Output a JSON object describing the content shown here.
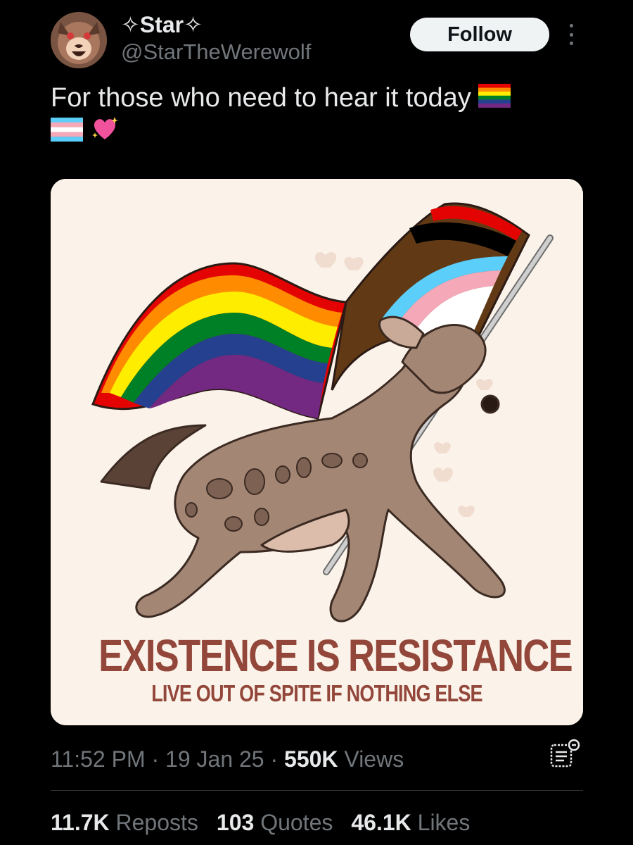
{
  "author": {
    "display_name": "✧Star✧",
    "handle": "@StarTheWerewolf"
  },
  "follow_label": "Follow",
  "tweet": {
    "text": "For those who need to hear it today"
  },
  "media": {
    "poster_title": "EXISTENCE IS RESISTANCE",
    "poster_subtitle": "LIVE OUT OF SPITE IF NOTHING ELSE"
  },
  "meta": {
    "time": "11:52 PM",
    "date": "19 Jan 25",
    "views_count": "550K",
    "views_label": "Views"
  },
  "stats": {
    "reposts_count": "11.7K",
    "reposts_label": "Reposts",
    "quotes_count": "103",
    "quotes_label": "Quotes",
    "likes_count": "46.1K",
    "likes_label": "Likes"
  },
  "colors": {
    "background": "#000000",
    "text_primary": "#e7e9ea",
    "text_secondary": "#71767b",
    "poster_text": "#93473a",
    "poster_bg": "#fbf3ea"
  }
}
